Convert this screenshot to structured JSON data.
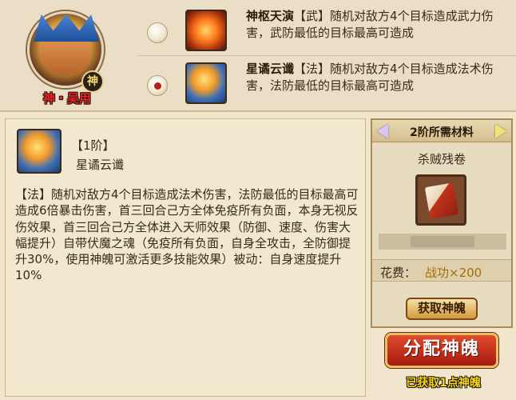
{
  "hero": {
    "badge": "神",
    "name": "神・吴用"
  },
  "skills": [
    {
      "selected": false,
      "title": "神枢天演",
      "tag": "【武】",
      "desc": "随机对敌方4个目标造成武力伤害，武防最低的目标最高可造成"
    },
    {
      "selected": true,
      "title": "星谲云谶",
      "tag": "【法】",
      "desc": "随机对敌方4个目标造成法术伤害，法防最低的目标最高可造成"
    }
  ],
  "detail": {
    "level": "【1阶】",
    "name": "星谲云谶",
    "description": "【法】随机对敌方4个目标造成法术伤害，法防最低的目标最高可造成6倍暴击伤害，首三回合己方全体免疫所有负面，本身无视反伤效果，首三回合己方全体进入天师效果（防御、速度、伤害大幅提升）自带伏魔之魂（免疫所有负面，自身全攻击，全防御提升30%，使用神魄可激活更多技能效果）被动：自身速度提升10%"
  },
  "materials": {
    "title": "2阶所需材料",
    "item_name": "杀贼残卷",
    "cost_label": "花费：",
    "cost_value": "战功×200",
    "get_button": "获取神魄"
  },
  "actions": {
    "assign_button": "分配神魄",
    "acquired_text": "已获取1点神魄"
  }
}
